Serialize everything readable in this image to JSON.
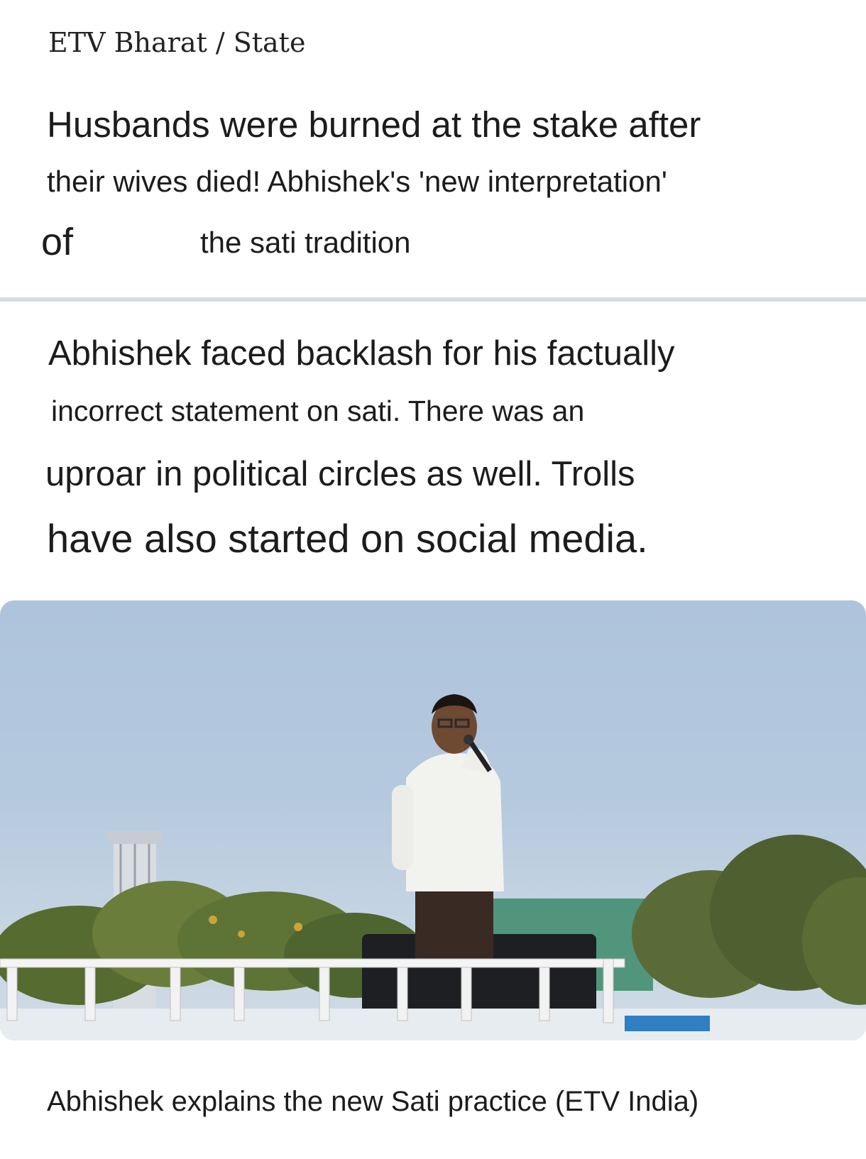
{
  "breadcrumb": "ETV Bharat / State",
  "headline": {
    "line1": "Husbands were burned at the stake after",
    "line2": "their wives died! Abhishek's 'new interpretation'",
    "line3_word": "of",
    "line3_rest": "the sati tradition"
  },
  "summary": {
    "line1": "Abhishek faced backlash for his factually",
    "line2": "incorrect statement on sati. There was an",
    "line3": "uproar in political circles as well. Trolls",
    "line4": "have also started on social media."
  },
  "photo": {
    "icon": "photo-icon",
    "sky_color": "#aec4dc"
  },
  "caption": "Abhishek explains the new Sati practice (ETV India)"
}
